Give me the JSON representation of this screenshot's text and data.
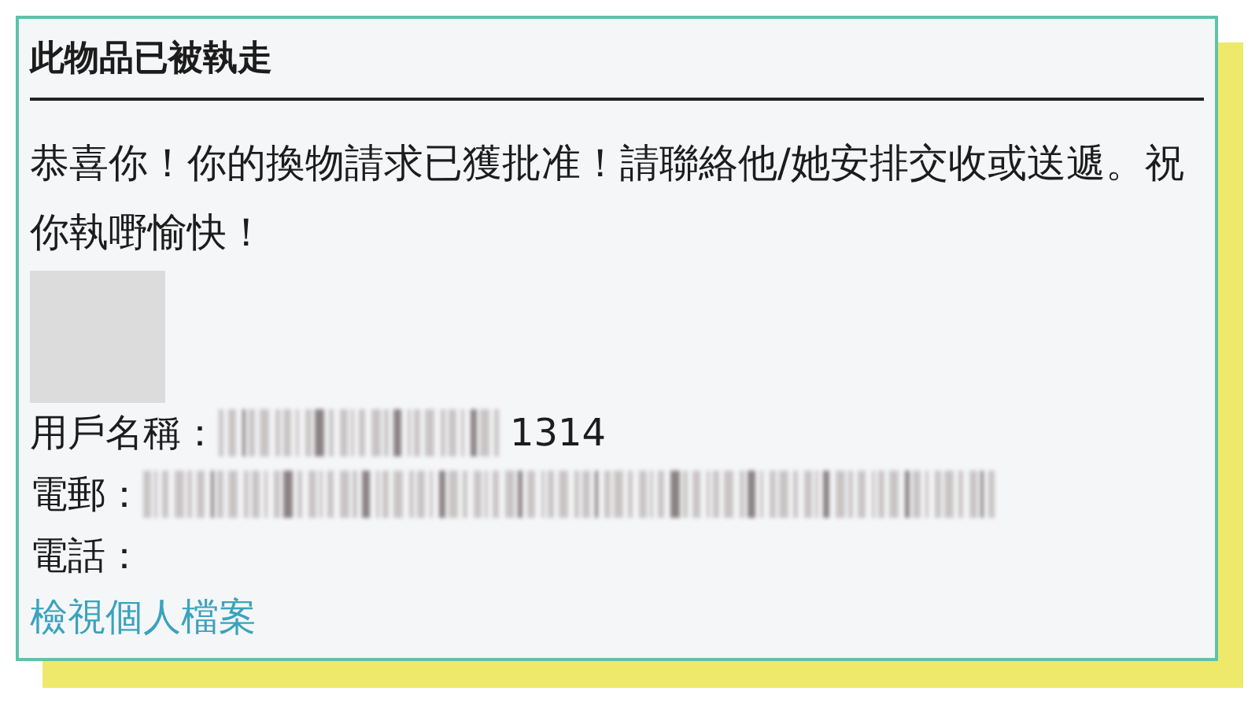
{
  "card": {
    "title": "此物品已被執走",
    "message": "恭喜你！你的換物請求已獲批准！請聯絡他/她安排交收或送遞。祝你執嘢愉快！",
    "fields": [
      {
        "label": "用戶名稱：",
        "kind": "partly_hidden",
        "value": "1314"
      },
      {
        "label": "電郵：",
        "kind": "hidden"
      },
      {
        "label": "電話：",
        "kind": "empty"
      }
    ],
    "profile_link": "檢視個人檔案"
  }
}
